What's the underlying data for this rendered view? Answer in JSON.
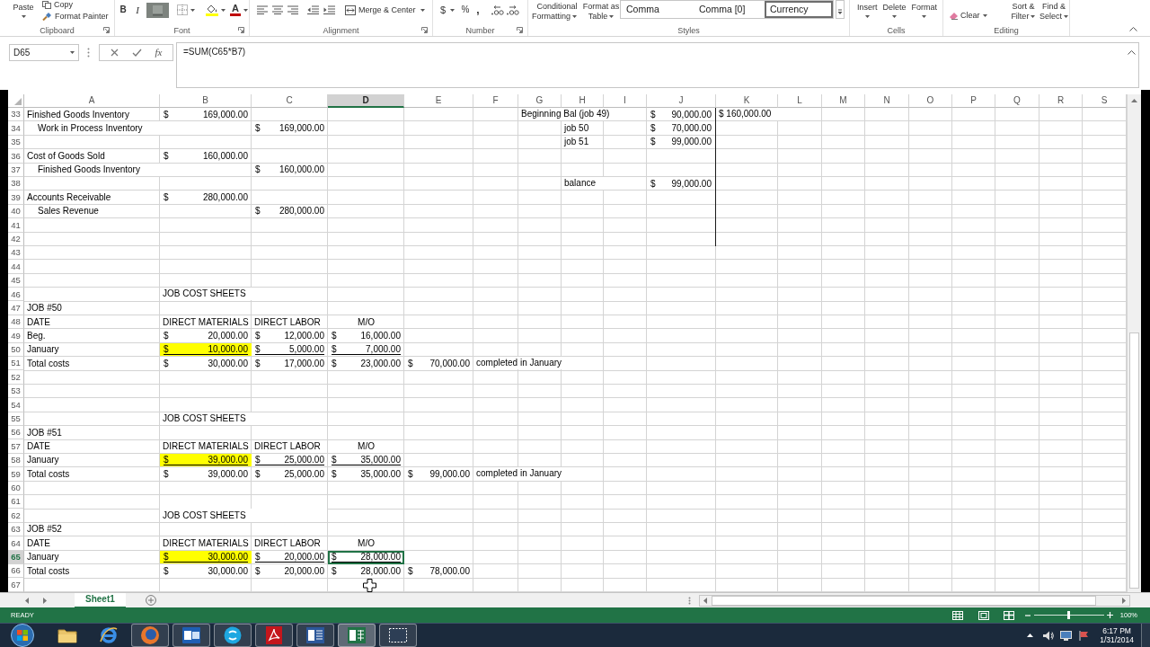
{
  "ribbon": {
    "groups": [
      {
        "kind": "clipboard",
        "label": "Clipboard",
        "launcher": true,
        "paste": "Paste",
        "copy": "Copy",
        "format_painter": "Format Painter"
      },
      {
        "kind": "font",
        "label": "Font",
        "launcher": true,
        "bold": "B",
        "italic": "I",
        "font_color": "A"
      },
      {
        "kind": "alignment",
        "label": "Alignment",
        "launcher": true,
        "merge": "Merge & Center"
      },
      {
        "kind": "number",
        "label": "Number",
        "launcher": true,
        "currency": "$",
        "percent": "%",
        "comma": ","
      },
      {
        "kind": "styles",
        "label": "Styles",
        "launcher": false,
        "conditional_formatting": [
          "Conditional",
          "Formatting"
        ],
        "format_as_table": [
          "Format as",
          "Table"
        ],
        "gallery": [
          {
            "label": "Comma",
            "selected": false
          },
          {
            "label": "Comma [0]",
            "selected": false
          },
          {
            "label": "Currency",
            "selected": true
          }
        ]
      },
      {
        "kind": "cells",
        "label": "Cells",
        "launcher": false,
        "buttons": [
          "Insert",
          "Delete",
          "Format"
        ]
      },
      {
        "kind": "editing",
        "label": "Editing",
        "launcher": false,
        "clear": "Clear",
        "sort_filter": [
          "Sort &",
          "Filter"
        ],
        "find_select": [
          "Find &",
          "Select"
        ]
      }
    ]
  },
  "formula_bar": {
    "name_box": "D65",
    "insert_function": "fx",
    "formula": "=SUM(C65*B7)"
  },
  "sheet": {
    "columns": [
      {
        "label": "A",
        "selected": false
      },
      {
        "label": "B",
        "selected": false
      },
      {
        "label": "C",
        "selected": false
      },
      {
        "label": "D",
        "selected": true
      },
      {
        "label": "E",
        "selected": false
      },
      {
        "label": "F",
        "selected": false
      },
      {
        "label": "G",
        "selected": false
      },
      {
        "label": "H",
        "selected": false
      },
      {
        "label": "I",
        "selected": false
      },
      {
        "label": "J",
        "selected": false
      },
      {
        "label": "K",
        "selected": false
      },
      {
        "label": "L",
        "selected": false
      },
      {
        "label": "M",
        "selected": false
      },
      {
        "label": "N",
        "selected": false
      },
      {
        "label": "O",
        "selected": false
      },
      {
        "label": "P",
        "selected": false
      },
      {
        "label": "Q",
        "selected": false
      },
      {
        "label": "R",
        "selected": false
      },
      {
        "label": "S",
        "selected": false
      }
    ],
    "rows": [
      {
        "number": "33",
        "selected": false,
        "cells": {
          "a": {
            "kind": "label",
            "text": "Finished Goods Inventory"
          },
          "b": {
            "kind": "currency",
            "symbol": "$",
            "amount": "169,000.00",
            "highlighted": false,
            "underlined": false,
            "selected": false
          },
          "g": {
            "kind": "label",
            "text": "Beginning Bal (job 49)"
          },
          "j": {
            "kind": "currency",
            "symbol": "$",
            "amount": "90,000.00",
            "highlighted": false,
            "underlined": false,
            "selected": false,
            "border_right": true
          },
          "k": {
            "kind": "label",
            "text": "$ 160,000.00"
          }
        }
      },
      {
        "number": "34",
        "selected": false,
        "cells": {
          "a": {
            "kind": "indented_label",
            "text": "Work in Process Inventory"
          },
          "c": {
            "kind": "currency",
            "symbol": "$",
            "amount": "169,000.00",
            "highlighted": false,
            "underlined": false,
            "selected": false
          },
          "h": {
            "kind": "label",
            "text": "job 50"
          },
          "j": {
            "kind": "currency",
            "symbol": "$",
            "amount": "70,000.00",
            "highlighted": false,
            "underlined": false,
            "selected": false,
            "border_right": true
          }
        }
      },
      {
        "number": "35",
        "selected": false,
        "cells": {
          "h": {
            "kind": "label",
            "text": "job 51"
          },
          "j": {
            "kind": "currency",
            "symbol": "$",
            "amount": "99,000.00",
            "highlighted": false,
            "underlined": false,
            "selected": false,
            "border_right": true
          }
        }
      },
      {
        "number": "36",
        "selected": false,
        "cells": {
          "a": {
            "kind": "label",
            "text": "Cost of Goods Sold"
          },
          "b": {
            "kind": "currency",
            "symbol": "$",
            "amount": "160,000.00",
            "highlighted": false,
            "underlined": false,
            "selected": false
          },
          "j": {
            "kind": "blank",
            "border_right": true
          }
        }
      },
      {
        "number": "37",
        "selected": false,
        "cells": {
          "a": {
            "kind": "indented_label",
            "text": "Finished Goods Inventory"
          },
          "c": {
            "kind": "currency",
            "symbol": "$",
            "amount": "160,000.00",
            "highlighted": false,
            "underlined": false,
            "selected": false
          },
          "j": {
            "kind": "blank",
            "border_right": true
          }
        }
      },
      {
        "number": "38",
        "selected": false,
        "cells": {
          "h": {
            "kind": "label",
            "text": "balance"
          },
          "j": {
            "kind": "currency",
            "symbol": "$",
            "amount": "99,000.00",
            "highlighted": false,
            "underlined": false,
            "selected": false,
            "border_right": true
          }
        }
      },
      {
        "number": "39",
        "selected": false,
        "cells": {
          "a": {
            "kind": "label",
            "text": "Accounts Receivable"
          },
          "b": {
            "kind": "currency",
            "symbol": "$",
            "amount": "280,000.00",
            "highlighted": false,
            "underlined": false,
            "selected": false
          },
          "j": {
            "kind": "blank",
            "border_right": true
          }
        }
      },
      {
        "number": "40",
        "selected": false,
        "cells": {
          "a": {
            "kind": "indented_label",
            "text": "Sales Revenue"
          },
          "c": {
            "kind": "currency",
            "symbol": "$",
            "amount": "280,000.00",
            "highlighted": false,
            "underlined": false,
            "selected": false
          },
          "j": {
            "kind": "blank",
            "border_right": true
          }
        }
      },
      {
        "number": "41",
        "selected": false,
        "cells": {
          "j": {
            "kind": "blank",
            "border_right": true
          }
        }
      },
      {
        "number": "42",
        "selected": false,
        "cells": {
          "j": {
            "kind": "blank",
            "border_right": true
          }
        }
      },
      {
        "number": "43",
        "selected": false
      },
      {
        "number": "44",
        "selected": false
      },
      {
        "number": "45",
        "selected": false
      },
      {
        "number": "46",
        "selected": false,
        "cells": {
          "b": {
            "kind": "label",
            "text": "JOB COST SHEETS"
          }
        }
      },
      {
        "number": "47",
        "selected": false,
        "cells": {
          "a": {
            "kind": "label",
            "text": "JOB #50"
          }
        }
      },
      {
        "number": "48",
        "selected": false,
        "cells": {
          "a": {
            "kind": "label",
            "text": "DATE"
          },
          "b": {
            "kind": "label",
            "text": "DIRECT MATERIALS"
          },
          "c": {
            "kind": "label",
            "text": "DIRECT LABOR"
          },
          "d": {
            "kind": "centered_label",
            "text": "M/O"
          }
        }
      },
      {
        "number": "49",
        "selected": false,
        "cells": {
          "a": {
            "kind": "label",
            "text": "Beg."
          },
          "b": {
            "kind": "currency",
            "symbol": "$",
            "amount": "20,000.00",
            "highlighted": false,
            "underlined": false,
            "selected": false
          },
          "c": {
            "kind": "currency",
            "symbol": "$",
            "amount": "12,000.00",
            "highlighted": false,
            "underlined": false,
            "selected": false
          },
          "d": {
            "kind": "currency",
            "symbol": "$",
            "amount": "16,000.00",
            "highlighted": false,
            "underlined": false,
            "selected": false
          }
        }
      },
      {
        "number": "50",
        "selected": false,
        "cells": {
          "a": {
            "kind": "label",
            "text": "January"
          },
          "b": {
            "kind": "currency",
            "symbol": "$",
            "amount": "10,000.00",
            "highlighted": true,
            "underlined": true,
            "selected": false
          },
          "c": {
            "kind": "currency",
            "symbol": "$",
            "amount": "5,000.00",
            "highlighted": false,
            "underlined": true,
            "selected": false
          },
          "d": {
            "kind": "currency",
            "symbol": "$",
            "amount": "7,000.00",
            "highlighted": false,
            "underlined": true,
            "selected": false
          }
        }
      },
      {
        "number": "51",
        "selected": false,
        "cells": {
          "a": {
            "kind": "label",
            "text": "Total costs"
          },
          "b": {
            "kind": "currency",
            "symbol": "$",
            "amount": "30,000.00",
            "highlighted": false,
            "underlined": false,
            "selected": false
          },
          "c": {
            "kind": "currency",
            "symbol": "$",
            "amount": "17,000.00",
            "highlighted": false,
            "underlined": false,
            "selected": false
          },
          "d": {
            "kind": "currency",
            "symbol": "$",
            "amount": "23,000.00",
            "highlighted": false,
            "underlined": false,
            "selected": false
          },
          "e": {
            "kind": "currency",
            "symbol": "$",
            "amount": "70,000.00",
            "highlighted": false,
            "underlined": false,
            "selected": false
          },
          "f": {
            "kind": "label",
            "text": "completed in January"
          }
        }
      },
      {
        "number": "52",
        "selected": false
      },
      {
        "number": "53",
        "selected": false
      },
      {
        "number": "54",
        "selected": false
      },
      {
        "number": "55",
        "selected": false,
        "cells": {
          "b": {
            "kind": "label",
            "text": "JOB COST SHEETS"
          }
        }
      },
      {
        "number": "56",
        "selected": false,
        "cells": {
          "a": {
            "kind": "label",
            "text": "JOB #51"
          }
        }
      },
      {
        "number": "57",
        "selected": false,
        "cells": {
          "a": {
            "kind": "label",
            "text": "DATE"
          },
          "b": {
            "kind": "label",
            "text": "DIRECT MATERIALS"
          },
          "c": {
            "kind": "label",
            "text": "DIRECT LABOR"
          },
          "d": {
            "kind": "centered_label",
            "text": "M/O"
          }
        }
      },
      {
        "number": "58",
        "selected": false,
        "cells": {
          "a": {
            "kind": "label",
            "text": "January"
          },
          "b": {
            "kind": "currency",
            "symbol": "$",
            "amount": "39,000.00",
            "highlighted": true,
            "underlined": true,
            "selected": false
          },
          "c": {
            "kind": "currency",
            "symbol": "$",
            "amount": "25,000.00",
            "highlighted": false,
            "underlined": true,
            "selected": false
          },
          "d": {
            "kind": "currency",
            "symbol": "$",
            "amount": "35,000.00",
            "highlighted": false,
            "underlined": true,
            "selected": false
          }
        }
      },
      {
        "number": "59",
        "selected": false,
        "cells": {
          "a": {
            "kind": "label",
            "text": "Total costs"
          },
          "b": {
            "kind": "currency",
            "symbol": "$",
            "amount": "39,000.00",
            "highlighted": false,
            "underlined": false,
            "selected": false
          },
          "c": {
            "kind": "currency",
            "symbol": "$",
            "amount": "25,000.00",
            "highlighted": false,
            "underlined": false,
            "selected": false
          },
          "d": {
            "kind": "currency",
            "symbol": "$",
            "amount": "35,000.00",
            "highlighted": false,
            "underlined": false,
            "selected": false
          },
          "e": {
            "kind": "currency",
            "symbol": "$",
            "amount": "99,000.00",
            "highlighted": false,
            "underlined": false,
            "selected": false
          },
          "f": {
            "kind": "label",
            "text": "completed in January"
          }
        }
      },
      {
        "number": "60",
        "selected": false
      },
      {
        "number": "61",
        "selected": false
      },
      {
        "number": "62",
        "selected": false,
        "cells": {
          "b": {
            "kind": "label",
            "text": "JOB COST SHEETS"
          }
        }
      },
      {
        "number": "63",
        "selected": false,
        "cells": {
          "a": {
            "kind": "label",
            "text": "JOB #52"
          }
        }
      },
      {
        "number": "64",
        "selected": false,
        "cells": {
          "a": {
            "kind": "label",
            "text": "DATE"
          },
          "b": {
            "kind": "label",
            "text": "DIRECT MATERIALS"
          },
          "c": {
            "kind": "label",
            "text": "DIRECT LABOR"
          },
          "d": {
            "kind": "centered_label",
            "text": "M/O"
          }
        }
      },
      {
        "number": "65",
        "selected": true,
        "cells": {
          "a": {
            "kind": "label",
            "text": "January"
          },
          "b": {
            "kind": "currency",
            "symbol": "$",
            "amount": "30,000.00",
            "highlighted": true,
            "underlined": true,
            "selected": false
          },
          "c": {
            "kind": "currency",
            "symbol": "$",
            "amount": "20,000.00",
            "highlighted": false,
            "underlined": true,
            "selected": false
          },
          "d": {
            "kind": "currency",
            "symbol": "$",
            "amount": "28,000.00",
            "highlighted": false,
            "underlined": true,
            "selected": true
          }
        }
      },
      {
        "number": "66",
        "selected": false,
        "cells": {
          "a": {
            "kind": "label",
            "text": "Total costs"
          },
          "b": {
            "kind": "currency",
            "symbol": "$",
            "amount": "30,000.00",
            "highlighted": false,
            "underlined": false,
            "selected": false
          },
          "c": {
            "kind": "currency",
            "symbol": "$",
            "amount": "20,000.00",
            "highlighted": false,
            "underlined": false,
            "selected": false
          },
          "d": {
            "kind": "currency",
            "symbol": "$",
            "amount": "28,000.00",
            "highlighted": false,
            "underlined": false,
            "selected": false
          },
          "e": {
            "kind": "currency",
            "symbol": "$",
            "amount": "78,000.00",
            "highlighted": false,
            "underlined": false,
            "selected": false
          }
        }
      },
      {
        "number": "67",
        "selected": false
      }
    ]
  },
  "sheet_tabs": [
    {
      "label": "Sheet1",
      "selected": true
    }
  ],
  "status_bar": {
    "status": "READY",
    "zoom_slider": {
      "level": 0.5
    },
    "zoom": "100%"
  },
  "taskbar": {
    "apps": [
      {
        "kind": "folder",
        "running": false,
        "selected": false
      },
      {
        "kind": "ring",
        "running": false,
        "selected": false
      },
      {
        "kind": "globe",
        "running": true,
        "selected": false
      },
      {
        "kind": "mail",
        "running": true,
        "selected": false
      },
      {
        "kind": "chat",
        "running": true,
        "selected": false
      },
      {
        "kind": "pdf",
        "running": true,
        "selected": false
      },
      {
        "kind": "document",
        "running": true,
        "selected": false
      },
      {
        "kind": "spreadsheet",
        "running": true,
        "selected": true
      },
      {
        "kind": "snip",
        "running": true,
        "selected": false
      }
    ],
    "clock": {
      "time": "6:17 PM",
      "date": "1/31/2014"
    }
  }
}
